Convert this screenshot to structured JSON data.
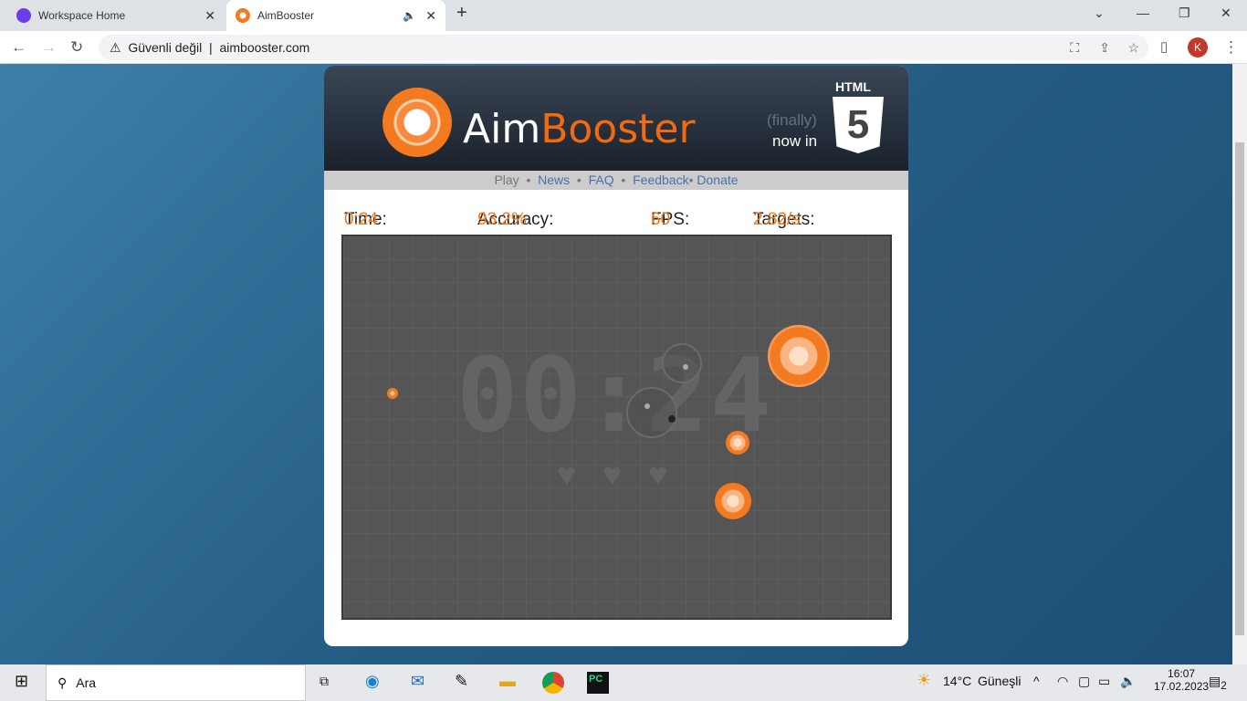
{
  "browser": {
    "tabs": [
      {
        "title": "Workspace Home"
      },
      {
        "title": "AimBooster"
      }
    ],
    "security": "Güvenli değil",
    "url": "aimbooster.com",
    "profile": "K"
  },
  "site": {
    "brand_a": "Aim",
    "brand_b": "Booster",
    "finally": "(finally)",
    "now_in": "now in",
    "html": "HTML",
    "html_num": "5",
    "menu": [
      {
        "label": "Play"
      },
      {
        "label": "News"
      },
      {
        "label": "FAQ"
      },
      {
        "label": "Feedback"
      },
      {
        "label": "Donate"
      }
    ],
    "stats": {
      "time_label": "Time:",
      "time": "0:24",
      "accuracy_label": "Accuracy:",
      "accuracy": "93.2%",
      "fps_label": "FPS:",
      "fps": "60",
      "targets_label": "Targets:",
      "targets": "2.82/s"
    },
    "game": {
      "big_timer": "00:24",
      "lives": 3,
      "accent": "#f47a20"
    }
  },
  "taskbar": {
    "search": "Ara",
    "weather": "14°C",
    "weather_text": "Güneşli",
    "time": "16:07",
    "date": "17.02.2023",
    "notifications": "2"
  }
}
